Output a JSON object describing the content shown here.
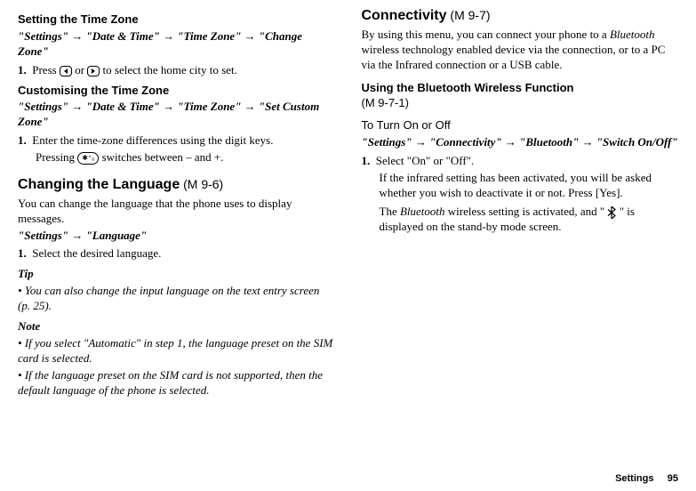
{
  "left": {
    "settingTZ": {
      "title": "Setting the Time Zone",
      "path_parts": [
        "\"Settings\"",
        "\"Date & Time\"",
        "\"Time Zone\"",
        "\"Change Zone\""
      ],
      "step1_prefix": "Press ",
      "step1_mid": " or ",
      "step1_suffix": " to select the home city to set."
    },
    "customTZ": {
      "title": "Customising the Time Zone",
      "path_parts": [
        "\"Settings\"",
        "\"Date & Time\"",
        "\"Time Zone\"",
        "\"Set Custom Zone\""
      ],
      "step1": "Enter the time-zone differences using the digit keys.",
      "step1b_prefix": "Pressing ",
      "step1b_suffix": " switches between – and +."
    },
    "lang": {
      "title": "Changing the Language",
      "code": " (M 9-6)",
      "intro": "You can change the language that the phone uses to display messages.",
      "path_parts": [
        "\"Settings\"",
        "\"Language\""
      ],
      "step1": "Select the desired language.",
      "tip_label": "Tip",
      "tip_body": "You can also change the input language on the text entry screen (p. 25).",
      "note_label": "Note",
      "note1": "If you select \"Automatic\" in step 1, the language preset on the SIM card is selected.",
      "note2": "If the language preset on the SIM card is not supported, then the default language of the phone is selected."
    }
  },
  "right": {
    "conn": {
      "title": "Connectivity",
      "code": " (M 9-7)",
      "intro_a": "By using this menu, you can connect your phone to a ",
      "intro_bt": "Bluetooth",
      "intro_b": " wireless technology enabled device via the connection, or to a PC via the Infrared connection or a USB cable."
    },
    "btfunc": {
      "title": "Using the Bluetooth Wireless Function",
      "code": " (M 9-7-1)",
      "sub": "To Turn On or Off",
      "path_parts": [
        "\"Settings\"",
        "\"Connectivity\"",
        "\"Bluetooth\"",
        "\"Switch On/Off\""
      ],
      "step1": "Select \"On\" or \"Off\".",
      "body1": "If the infrared setting has been activated, you will be asked whether you wish to deactivate it or not. Press [Yes].",
      "body2a": "The ",
      "body2bt": "Bluetooth",
      "body2b": " wireless setting is activated, and \" ",
      "body2c": " \" is displayed on the stand-by mode screen."
    }
  },
  "footer": {
    "section": "Settings",
    "page": "95"
  },
  "glyphs": {
    "arrow": "→",
    "starkey": "✱⁺₀"
  }
}
